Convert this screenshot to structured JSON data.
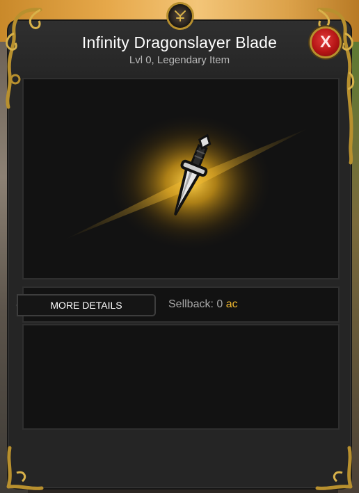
{
  "item": {
    "name": "Infinity Dragonslayer Blade",
    "info": "Lvl 0, Legendary Item"
  },
  "actions": {
    "close_label": "X",
    "more_details_label": "MORE DETAILS"
  },
  "sellback": {
    "label": "Sellback: 0",
    "currency": "ac"
  },
  "colors": {
    "rarity_glow": "#f0b82f",
    "frame_gold": "#b8902e",
    "close_red": "#c41c1c",
    "currency_ac": "#f0b82f"
  },
  "icons": {
    "item": "dagger-icon",
    "emblem": "crest-emblem-icon",
    "close": "close-icon"
  }
}
